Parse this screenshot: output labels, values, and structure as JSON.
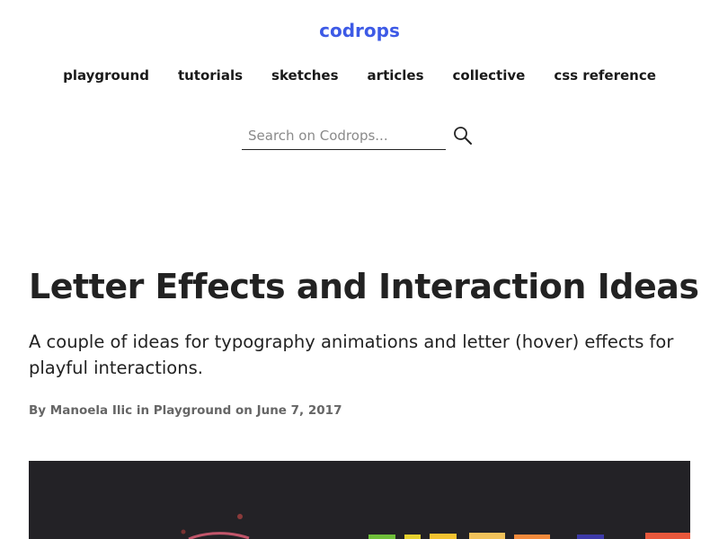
{
  "site": {
    "brand": "codrops",
    "brand_color": "#3d5ae6"
  },
  "nav": {
    "items": [
      {
        "label": "playground"
      },
      {
        "label": "tutorials"
      },
      {
        "label": "sketches"
      },
      {
        "label": "articles"
      },
      {
        "label": "collective"
      },
      {
        "label": "css reference"
      }
    ]
  },
  "search": {
    "placeholder": "Search on Codrops...",
    "value": "",
    "icon": "search-icon"
  },
  "article": {
    "title": "Letter Effects and Interaction Ideas",
    "subtitle": "A couple of ideas for typography animations and letter (hover) effects for playful interactions.",
    "byline": {
      "prefix": "By",
      "author": "Manoela Ilic",
      "in_word": "in",
      "category": "Playground",
      "on_word": "on",
      "date": "June 7, 2017"
    },
    "hero": {
      "background": "#232226"
    }
  }
}
